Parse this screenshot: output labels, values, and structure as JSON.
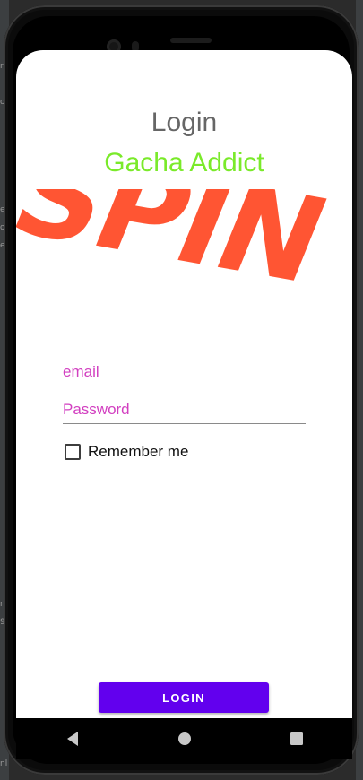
{
  "login_screen": {
    "title": "Login",
    "subtitle": "Gacha Addict",
    "logo_text": "SPIN",
    "email": {
      "value": "",
      "placeholder": "email"
    },
    "password": {
      "value": "",
      "placeholder": "Password"
    },
    "remember_me": {
      "label": "Remember me",
      "checked": false
    },
    "login_button_label": "LOGIN"
  },
  "nav_bar": {
    "icons": [
      "back-icon",
      "home-icon",
      "recents-icon"
    ]
  },
  "colors": {
    "title": "#666666",
    "subtitle": "#7aea2a",
    "logo": "#ff5533",
    "field_text": "#d23fc0",
    "button": "#6200ee"
  }
}
